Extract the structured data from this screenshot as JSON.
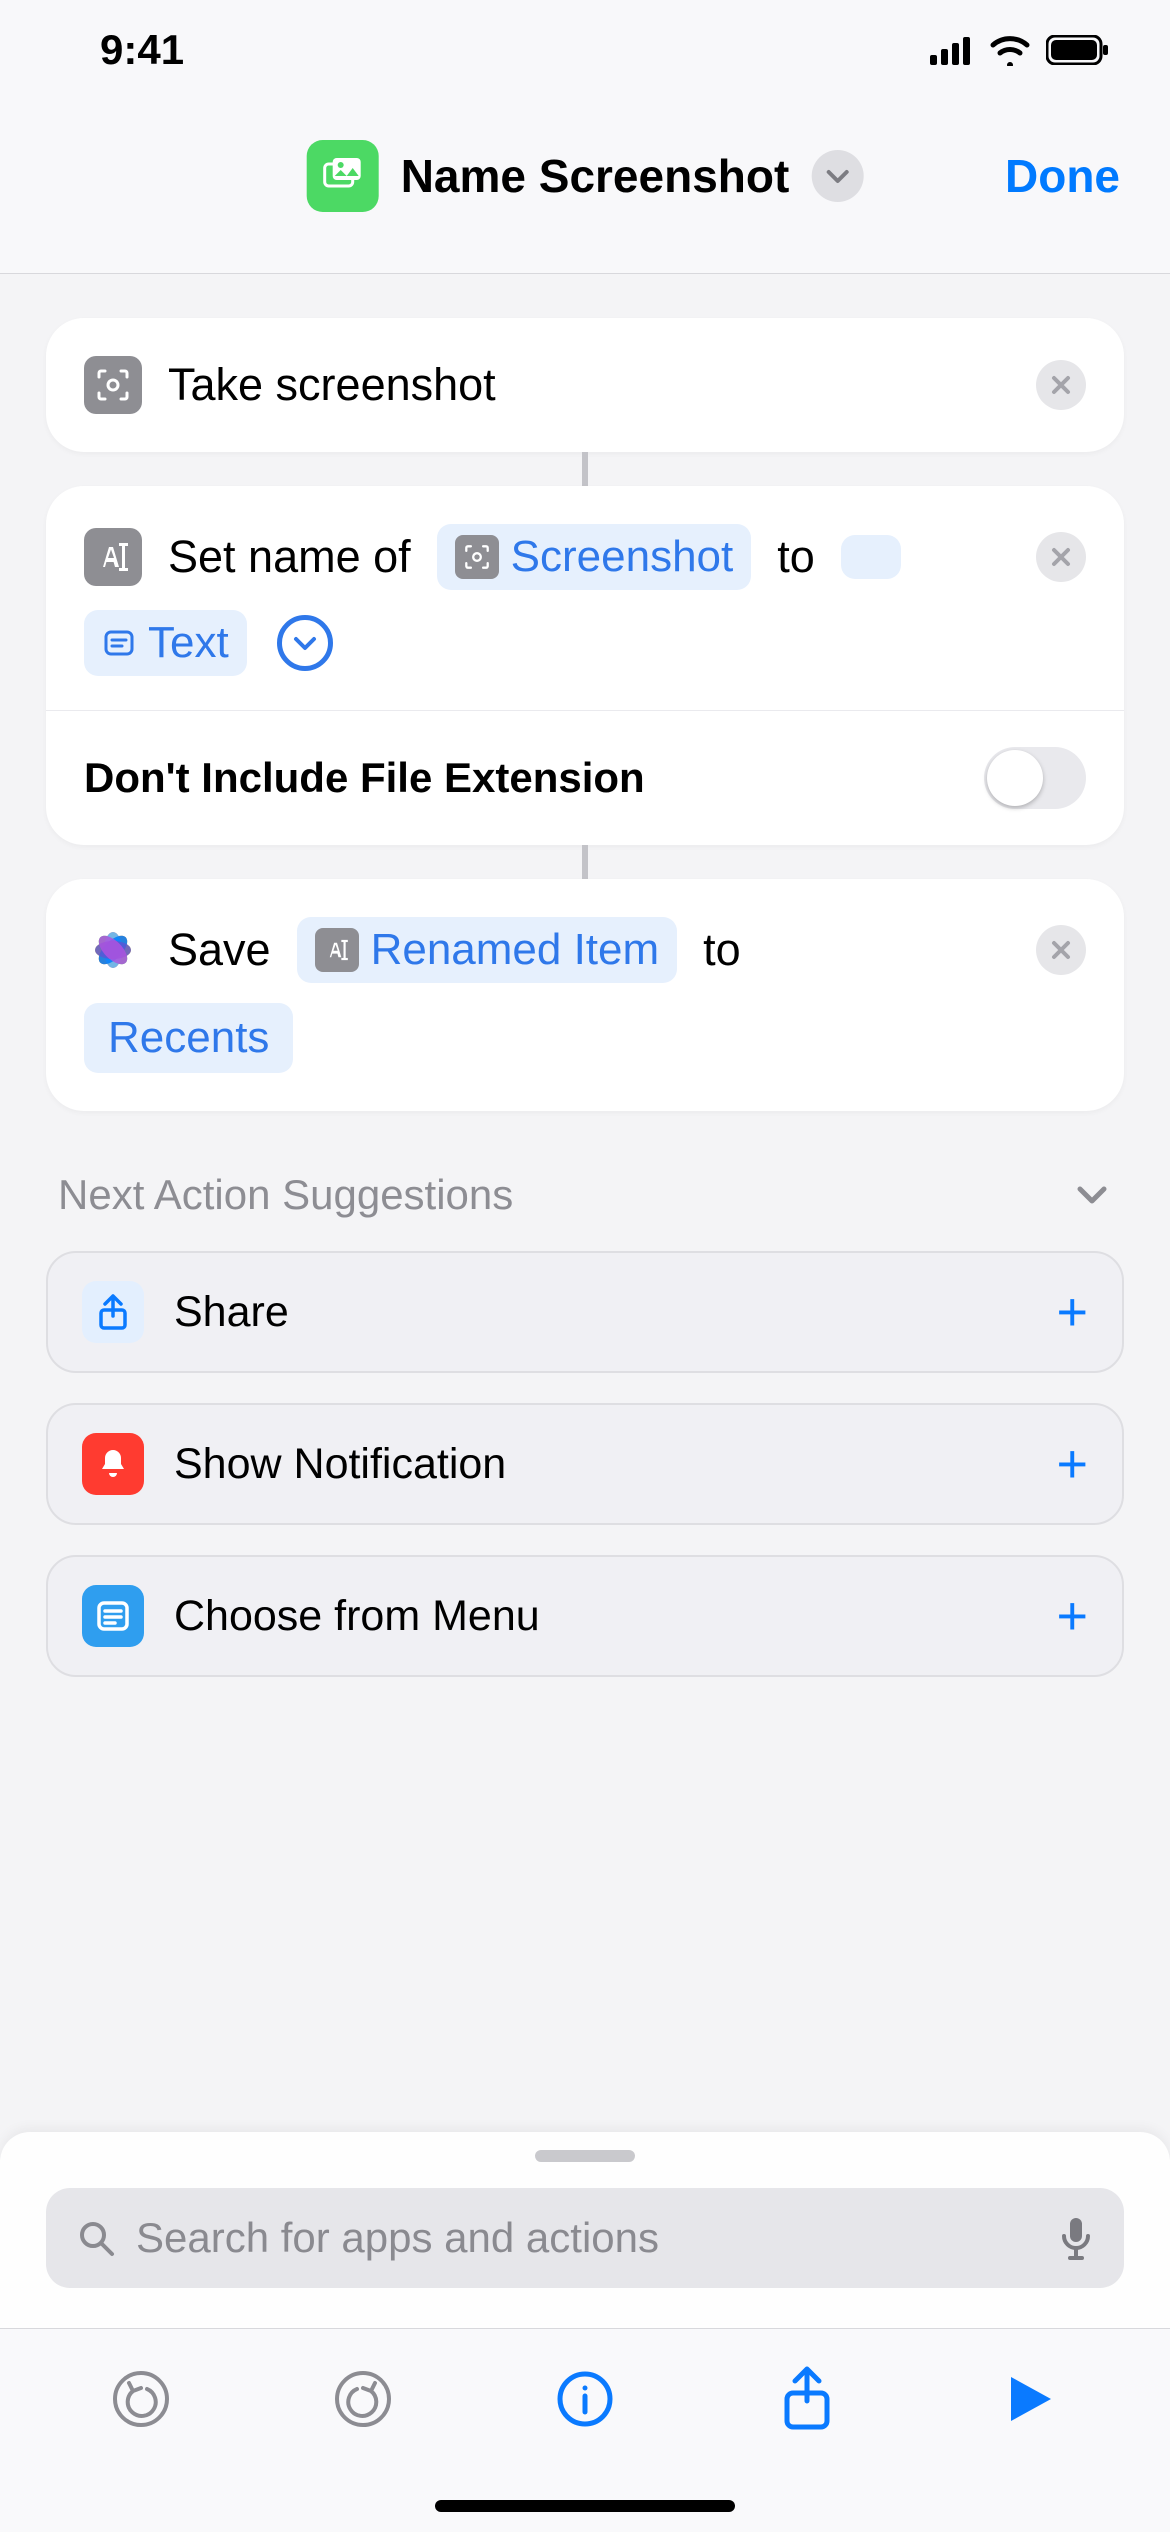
{
  "status": {
    "time": "9:41"
  },
  "header": {
    "title": "Name Screenshot",
    "done": "Done"
  },
  "actions": {
    "takeScreenshot": {
      "label": "Take screenshot"
    },
    "setName": {
      "prefix": "Set name of",
      "inputToken": "Screenshot",
      "mid": "to",
      "textToken": "Text",
      "option": "Don't Include File Extension"
    },
    "save": {
      "prefix": "Save",
      "inputToken": "Renamed Item",
      "mid": "to",
      "dest": "Recents"
    }
  },
  "suggestions": {
    "header": "Next Action Suggestions",
    "items": [
      {
        "label": "Share"
      },
      {
        "label": "Show Notification"
      },
      {
        "label": "Choose from Menu"
      }
    ]
  },
  "search": {
    "placeholder": "Search for apps and actions"
  }
}
